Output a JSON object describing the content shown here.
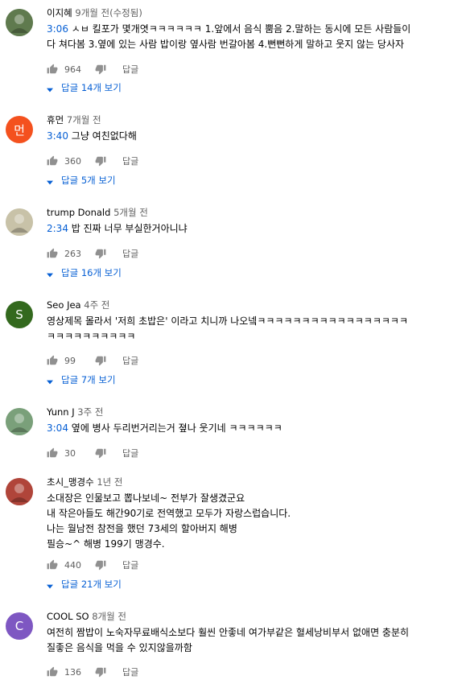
{
  "comments": [
    {
      "avatar": {
        "kind": "photo",
        "color": "#5f7a4e"
      },
      "author": "이지혜",
      "time": "9개월 전(수정됨)",
      "lines": [
        {
          "ts": "3:06",
          "text": "ㅅㅂ 킬포가 몇개엿ㅋㅋㅋㅋㅋㅋ 1.앞에서 음식 뿜음 2.말하는 동시에 모든 사람들이"
        },
        {
          "ts": "",
          "text": "다 쳐다봄 3.옆에 있는 사람 밥이랑 옆사람 번갈아봄 4.뻔뻔하게 말하고 웃지 않는 당사자"
        }
      ],
      "likes": "964",
      "reply_label": "답글",
      "replies": "답글 14개 보기"
    },
    {
      "avatar": {
        "kind": "letter",
        "letter": "먼",
        "color": "#f4511e"
      },
      "author": "휴먼",
      "time": "7개월 전",
      "lines": [
        {
          "ts": "3:40",
          "text": "그냥 여친없다해"
        }
      ],
      "likes": "360",
      "reply_label": "답글",
      "replies": "답글 5개 보기"
    },
    {
      "avatar": {
        "kind": "photo",
        "color": "#c8c2a8"
      },
      "author": "trump Donald",
      "time": "5개월 전",
      "lines": [
        {
          "ts": "2:34",
          "text": "밥 진짜 너무 부실한거아니냐"
        }
      ],
      "likes": "263",
      "reply_label": "답글",
      "replies": "답글 16개 보기"
    },
    {
      "avatar": {
        "kind": "letter",
        "letter": "S",
        "color": "#33691e"
      },
      "author": "Seo Jea",
      "time": "4주 전",
      "lines": [
        {
          "ts": "",
          "text": "영상제목 몰라서 '저희 초밥은' 이라고 치니까 나오넼ㅋㅋㅋㅋㅋㅋㅋㅋㅋㅋㅋㅋㅋㅋㅋㅋㅋ"
        },
        {
          "ts": "",
          "text": "ㅋㅋㅋㅋㅋㅋㅋㅋㅋㅋ"
        }
      ],
      "likes": "99",
      "reply_label": "답글",
      "replies": "답글 7개 보기"
    },
    {
      "avatar": {
        "kind": "photo",
        "color": "#7aa07a"
      },
      "author": "Yunn J",
      "time": "3주 전",
      "lines": [
        {
          "ts": "3:04",
          "text": "옆에 병사 두리번거리는거 졒나 웃기네 ㅋㅋㅋㅋㅋㅋ"
        }
      ],
      "likes": "30",
      "reply_label": "답글",
      "replies": ""
    },
    {
      "avatar": {
        "kind": "photo",
        "color": "#b0453a"
      },
      "author": "초시_맹경수",
      "time": "1년 전",
      "lines": [
        {
          "ts": "",
          "text": "소대장은 인물보고 뽑나보네~  전부가 잘생겼군요"
        },
        {
          "ts": "",
          "text": "내 작은아들도 해간90기로 전역했고 모두가 자랑스럽습니다."
        },
        {
          "ts": "",
          "text": "나는 월남전 참전을 했던 73세의 할아버지 해병"
        },
        {
          "ts": "",
          "text": "필승~^  해병 199기 맹경수."
        }
      ],
      "likes": "440",
      "reply_label": "답글",
      "replies": "답글 21개 보기"
    },
    {
      "avatar": {
        "kind": "letter",
        "letter": "C",
        "color": "#7e57c2"
      },
      "author": "COOL SO",
      "time": "8개월 전",
      "lines": [
        {
          "ts": "",
          "text": "여전히 짬밥이 노숙자무료배식소보다 훨씬 안좋네 여가부같은 혈세낭비부서 없애면 충분히"
        },
        {
          "ts": "",
          "text": "질좋은 음식을 먹을 수 있지않을까함"
        }
      ],
      "likes": "136",
      "reply_label": "답글",
      "replies": ""
    }
  ]
}
